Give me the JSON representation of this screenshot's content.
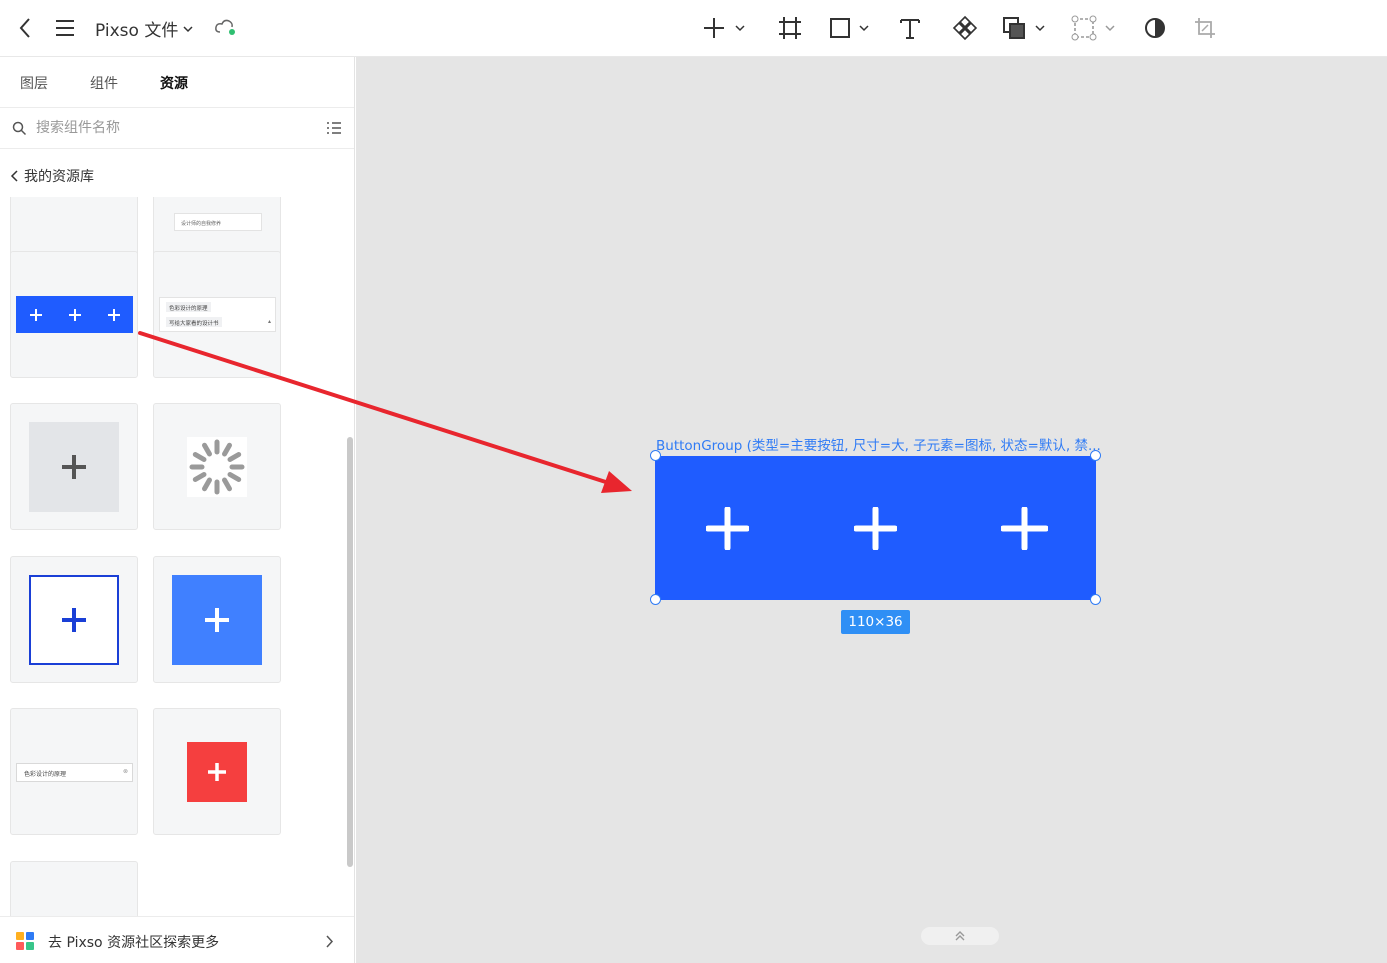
{
  "app": {
    "title": "Pixso 文件",
    "toolbar_icons": [
      "back-icon",
      "menu-icon",
      "cloud-icon",
      "add-icon",
      "frame-icon",
      "rectangle-icon",
      "text-icon",
      "component-icon",
      "boolean-icon",
      "instance-icon",
      "mask-icon",
      "crop-icon"
    ]
  },
  "sidebar": {
    "tabs": [
      {
        "label": "图层"
      },
      {
        "label": "组件"
      },
      {
        "label": "资源"
      }
    ],
    "active_tab": "资源",
    "search": {
      "placeholder": "搜索组件名称"
    },
    "back_label": "我的资源库",
    "thumb_texts": {
      "top_card": "设计师的自我修养",
      "tag_1": "色彩设计的原理",
      "tag_2": "写给大家看的设计书",
      "select_text": "色彩设计的原理"
    },
    "footer_label": "去 Pixso 资源社区探索更多"
  },
  "canvas": {
    "selection_label": "ButtonGroup (类型=主要按钮, 尺寸=大, 子元素=图标, 状态=默认, 禁...",
    "dimensions": "110×36",
    "button_count": 3
  },
  "colors": {
    "primary_blue": "#1f5cff",
    "light_blue": "#4080ff",
    "danger_red": "#f53f3f",
    "selection_blue": "#2f7bf5",
    "annotation_arrow": "#e8262e",
    "canvas_bg": "#e5e5e5"
  }
}
